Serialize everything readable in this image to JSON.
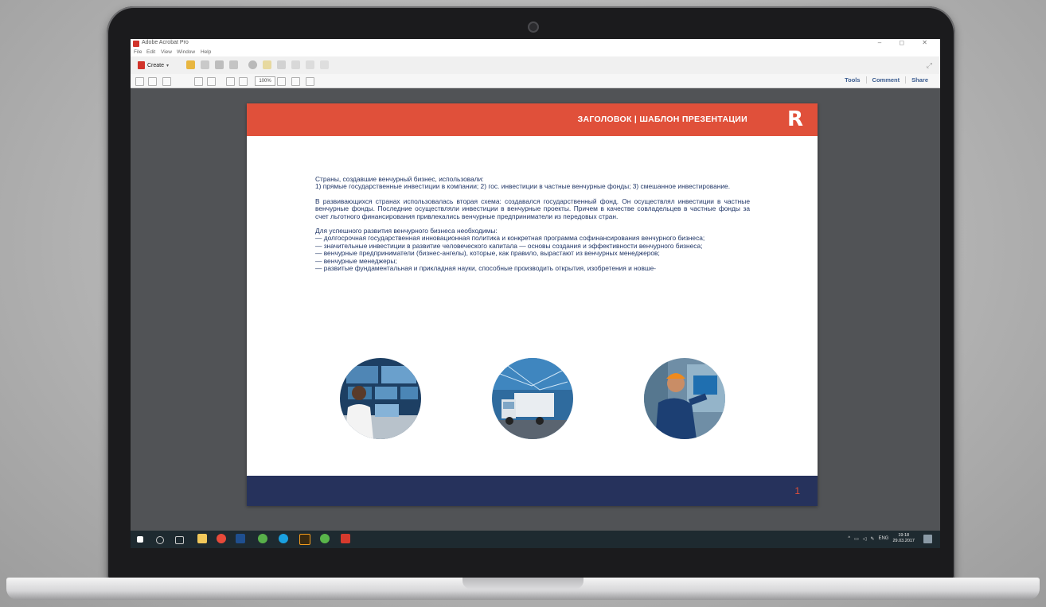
{
  "window": {
    "title": "Adobe Acrobat Pro",
    "controls": "–  ◻  ✕"
  },
  "menubar": {
    "items": [
      "File",
      "Edit",
      "View",
      "Window",
      "Help"
    ]
  },
  "toolbar": {
    "create_label": "Create",
    "zoom": "100%",
    "tabs": [
      "Tools",
      "Comment",
      "Share"
    ]
  },
  "slide": {
    "title": "ЗАГОЛОВОК | ШАБЛОН ПРЕЗЕНТАЦИИ",
    "logo": "R",
    "paragraph_1": "Страны, создавшие венчурный бизнес, использовали:\n1) прямые государственные инвестиции в компании; 2) гос. инвестиции в частные венчурные фонды; 3) смешанное инвестирование.",
    "paragraph_2": "В развивающихся странах использовалась вторая схема: создавался государственный фонд. Он осуществлял инвестиции в частные венчурные фонды. Последние осуществляли инвестиции в венчурные проекты. Причем в качестве совладельцев в частные фонды за счет льготного финансирования привлекались венчурные предприниматели из передовых стран.",
    "paragraph_3": "Для успешного развития венчурного бизнеса необходимы:\n— долгосрочная государственная инновационная политика и конкретная программа софинансирования венчурного бизнеса;\n— значительные инвестиции в развитие человеческого капитала — основы создания и эффективности венчурного бизнеса;\n— венчурные предприниматели (бизнес-ангелы), которые, как правило, вырастают из венчурных менеджеров;\n— венчурные менеджеры;\n— развитые фундаментальная и прикладная науки, способные производить открытия, изобретения и новше-",
    "page_number": "1",
    "colors": {
      "header": "#e0503a",
      "footer": "#26325c",
      "text": "#1f3566"
    }
  },
  "taskbar": {
    "language": "ENG",
    "time": "19:18",
    "date": "29.03.2017"
  }
}
